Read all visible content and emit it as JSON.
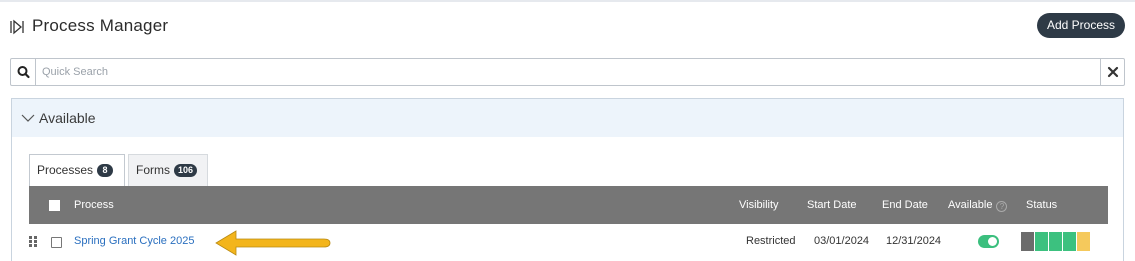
{
  "header": {
    "title": "Process Manager",
    "add_button": "Add Process"
  },
  "search": {
    "placeholder": "Quick Search",
    "value": ""
  },
  "panel": {
    "label": "Available"
  },
  "tabs": [
    {
      "label": "Processes",
      "count": "8"
    },
    {
      "label": "Forms",
      "count": "106"
    }
  ],
  "table": {
    "columns": [
      "Process",
      "Visibility",
      "Start Date",
      "End Date",
      "Available",
      "Status"
    ],
    "rows": [
      {
        "process": "Spring Grant Cycle 2025",
        "visibility": "Restricted",
        "start": "03/01/2024",
        "end": "12/31/2024",
        "available": true,
        "status_colors": [
          "#6c6c6c",
          "#3cc17f",
          "#3cc17f",
          "#3cc17f",
          "#f5c95c"
        ]
      }
    ]
  },
  "colors": {
    "accent": "#2a6fbf",
    "toggle_on": "#3bbf7e",
    "header_bg": "#767676",
    "button_bg": "#2e3a46",
    "annotation_arrow": "#f3b51c"
  }
}
